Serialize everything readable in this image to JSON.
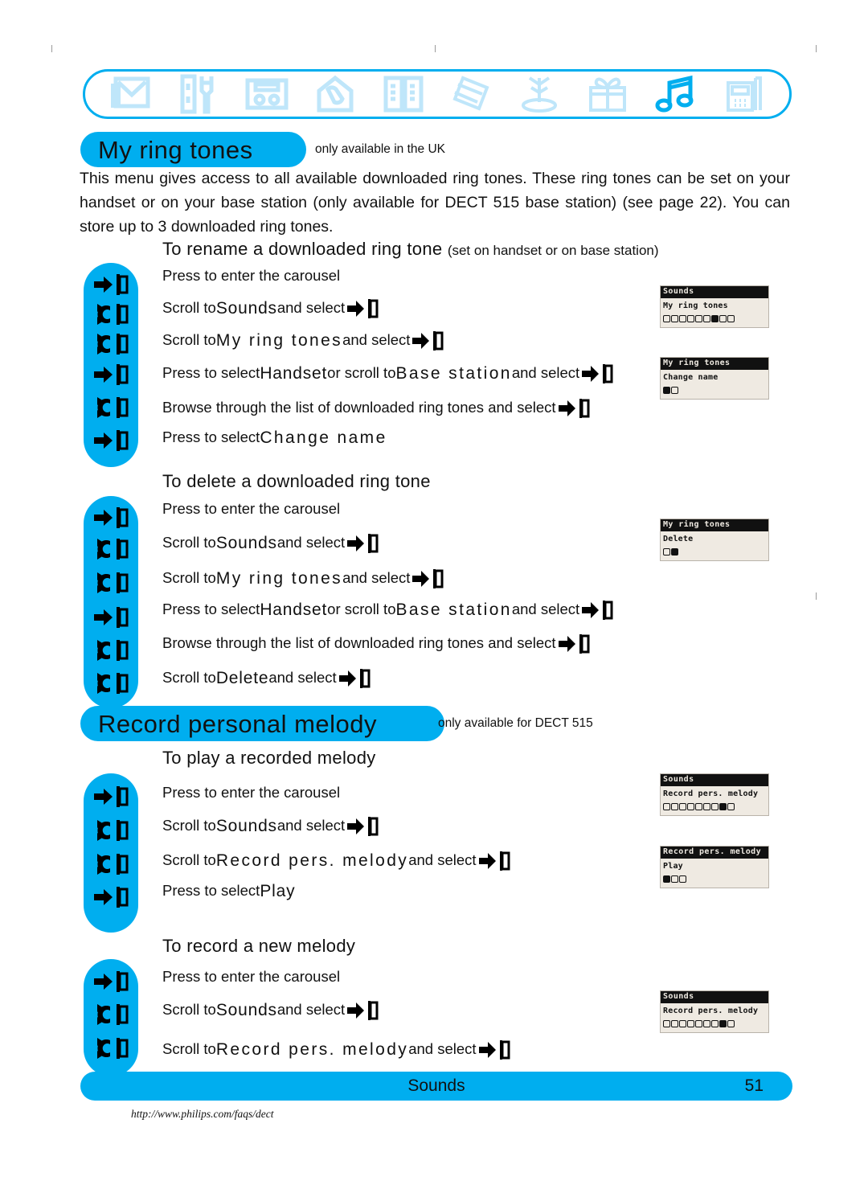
{
  "carousel": {
    "icons": [
      {
        "name": "envelope-icon",
        "label": "Messages"
      },
      {
        "name": "tools-icon",
        "label": "Personal settings"
      },
      {
        "name": "base-station-icon",
        "label": "Base settings"
      },
      {
        "name": "house-phone-icon",
        "label": "Home"
      },
      {
        "name": "open-book-icon",
        "label": "Phonebook"
      },
      {
        "name": "banknotes-icon",
        "label": "Cost"
      },
      {
        "name": "antenna-icon",
        "label": "Network"
      },
      {
        "name": "gift-box-icon",
        "label": "Extras"
      },
      {
        "name": "music-note-icon",
        "label": "Sounds"
      },
      {
        "name": "handset-icon",
        "label": "Handset"
      }
    ],
    "selected_index": 8
  },
  "sections": [
    {
      "pill": "My ring tones",
      "note": "only available in the UK",
      "intro": "This menu gives access to all available downloaded ring tones. These ring tones can be set on your handset or on your base station (only available for DECT 515 base station) (see page 22). You can store up to 3 downloaded ring tones.",
      "subsections": [
        {
          "heading": "To rename a downloaded ring tone",
          "heading_note": "(set on handset or on base station)",
          "keys": [
            "press",
            "scroll",
            "scroll",
            "press",
            "scroll",
            "press"
          ],
          "steps": [
            {
              "pre": "Press to enter the carousel",
              "kw": "",
              "post": "",
              "key": false
            },
            {
              "pre": "Scroll to ",
              "kw": "Sounds",
              "post": " and select ",
              "key": true
            },
            {
              "pre": "Scroll to ",
              "kw": "My ring tones",
              "post": " and select ",
              "key": true
            },
            {
              "pre": "Press to select ",
              "kw": "Handset",
              "mid": " or scroll to ",
              "kw2": "Base station",
              "post": " and select ",
              "key": true
            },
            {
              "pre": "Browse through the list of downloaded ring tones and select ",
              "kw": "",
              "post": "",
              "key": true
            },
            {
              "pre": "Press to select ",
              "kw": "Change name",
              "post": "",
              "key": false
            }
          ],
          "screens": [
            {
              "title": "Sounds",
              "body": "My ring tones",
              "dots": 9,
              "active": 7
            },
            {
              "title": "My ring tones",
              "body": "Change name",
              "dots": 2,
              "active": 1
            }
          ]
        },
        {
          "heading": "To delete a downloaded ring tone",
          "heading_note": "",
          "keys": [
            "press",
            "scroll",
            "scroll",
            "press",
            "scroll",
            "scroll"
          ],
          "steps": [
            {
              "pre": "Press to enter the carousel",
              "kw": "",
              "post": "",
              "key": false
            },
            {
              "pre": "Scroll to ",
              "kw": "Sounds",
              "post": " and select ",
              "key": true
            },
            {
              "pre": "Scroll to ",
              "kw": "My ring tones",
              "post": " and select ",
              "key": true
            },
            {
              "pre": "Press to select ",
              "kw": "Handset",
              "mid": " or scroll to ",
              "kw2": "Base station",
              "post": " and select ",
              "key": true
            },
            {
              "pre": "Browse through the list of downloaded ring tones and select ",
              "kw": "",
              "post": "",
              "key": true
            },
            {
              "pre": "Scroll to ",
              "kw": "Delete",
              "post": " and select ",
              "key": true
            }
          ],
          "screens": [
            {
              "title": "My ring tones",
              "body": "Delete",
              "dots": 2,
              "active": 2
            }
          ]
        }
      ]
    },
    {
      "pill": "Record personal melody",
      "note": "only available for DECT 515",
      "intro": "",
      "subsections": [
        {
          "heading": "To play a recorded melody",
          "heading_note": "",
          "keys": [
            "press",
            "scroll",
            "scroll",
            "press"
          ],
          "steps": [
            {
              "pre": "Press to enter the carousel",
              "kw": "",
              "post": "",
              "key": false
            },
            {
              "pre": "Scroll to ",
              "kw": "Sounds",
              "post": " and select ",
              "key": true
            },
            {
              "pre": "Scroll to ",
              "kw": "Record pers. melody",
              "post": " and select ",
              "key": true
            },
            {
              "pre": "Press to select ",
              "kw": "Play",
              "post": "",
              "key": false
            }
          ],
          "screens": [
            {
              "title": "Sounds",
              "body": "Record pers. melody",
              "dots": 9,
              "active": 8
            },
            {
              "title": "Record pers. melody",
              "body": "Play",
              "dots": 3,
              "active": 1
            }
          ]
        },
        {
          "heading": "To record a new melody",
          "heading_note": "",
          "keys": [
            "press",
            "scroll",
            "scroll"
          ],
          "steps": [
            {
              "pre": "Press to enter the carousel",
              "kw": "",
              "post": "",
              "key": false
            },
            {
              "pre": "Scroll to ",
              "kw": "Sounds",
              "post": " and select ",
              "key": true
            },
            {
              "pre": "Scroll to ",
              "kw": "Record pers. melody",
              "post": " and select ",
              "key": true
            }
          ],
          "screens": [
            {
              "title": "Sounds",
              "body": "Record pers. melody",
              "dots": 9,
              "active": 8
            }
          ]
        }
      ]
    }
  ],
  "footer": {
    "title": "Sounds",
    "page": "51",
    "url": "http://www.philips.com/faqs/dect"
  },
  "colors": {
    "accent": "#00AEEF",
    "icon_light": "#BFE6FA",
    "lcd_bg": "#EFEAE2",
    "lcd_ink": "#111111"
  }
}
